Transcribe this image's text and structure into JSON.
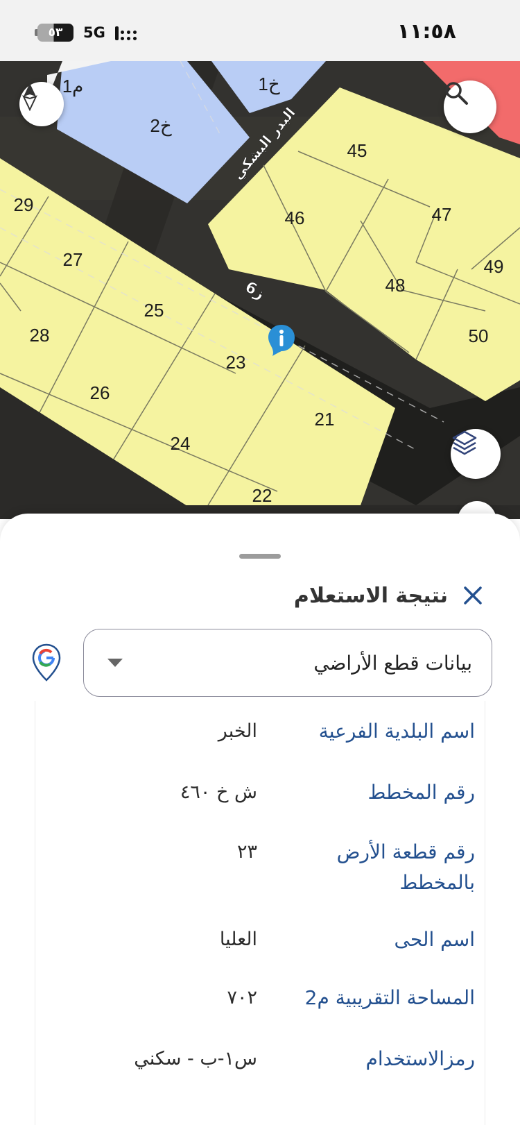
{
  "status_bar": {
    "time": "١١:٥٨",
    "battery": "٥٣",
    "network": "5G"
  },
  "map": {
    "plot_numbers": [
      "45",
      "46",
      "47",
      "48",
      "49",
      "50",
      "29",
      "27",
      "25",
      "28",
      "23",
      "26",
      "21",
      "24",
      "22"
    ],
    "parcel_labels": [
      "م1",
      "خ2",
      "خ1"
    ],
    "street_names": [
      "البدر البشكي",
      "ز6"
    ],
    "buttons": [
      "compass-icon",
      "search-icon",
      "layers-icon",
      "info-marker-icon"
    ],
    "colors": {
      "plot": "#f5f3a0",
      "service_lot": "#b9cdf5",
      "commercial_lot": "#f26b6b",
      "road": "#2b2a28"
    }
  },
  "sheet": {
    "title": "نتيجة الاستعلام",
    "dropdown_value": "بيانات قطع الأراضي",
    "rows": [
      {
        "label": "اسم البلدية الفرعية",
        "value": "الخبر"
      },
      {
        "label": "رقم المخطط",
        "value": "ش خ ٤٦٠"
      },
      {
        "label": "رقم قطعة الأرض بالمخطط",
        "value": "٢٣"
      },
      {
        "label": "اسم الحى",
        "value": "العليا"
      },
      {
        "label": "المساحة التقريبية م2",
        "value": "٧٠٢"
      },
      {
        "label": "رمزالاستخدام",
        "value": "س١-ب - سكني"
      }
    ]
  }
}
